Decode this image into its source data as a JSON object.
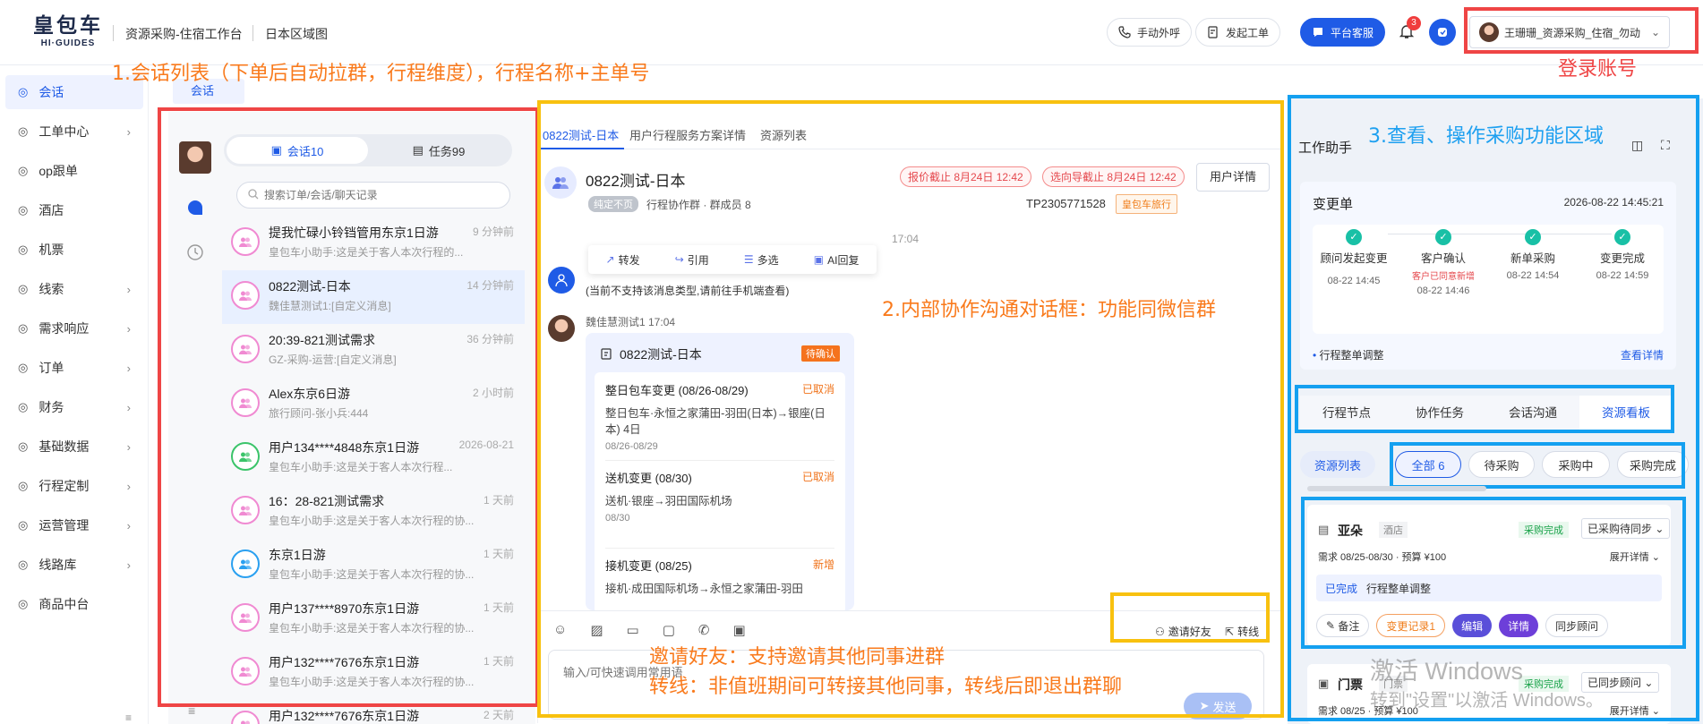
{
  "brand": {
    "name_cn": "皇包车",
    "name_en": "HI·GUIDES"
  },
  "header": {
    "workspace": "资源采购-住宿工作台",
    "region": "日本区域图",
    "call_label": "手动外呼",
    "ticket_label": "发起工单",
    "service_label": "平台客服",
    "notification_count": "3",
    "user_label": "王珊珊_资源采购_住宿_勿动"
  },
  "sidebar": {
    "items": [
      {
        "label": "会话",
        "icon": "chat-icon"
      },
      {
        "label": "工单中心",
        "icon": "ticket-icon"
      },
      {
        "label": "op跟单",
        "icon": "track-icon"
      },
      {
        "label": "酒店",
        "icon": "hotel-icon"
      },
      {
        "label": "机票",
        "icon": "plane-icon"
      },
      {
        "label": "线索",
        "icon": "lead-icon"
      },
      {
        "label": "需求响应",
        "icon": "demand-icon"
      },
      {
        "label": "订单",
        "icon": "order-icon"
      },
      {
        "label": "财务",
        "icon": "finance-icon"
      },
      {
        "label": "基础数据",
        "icon": "data-icon"
      },
      {
        "label": "行程定制",
        "icon": "itinerary-icon"
      },
      {
        "label": "运营管理",
        "icon": "ops-icon"
      },
      {
        "label": "线路库",
        "icon": "route-icon"
      },
      {
        "label": "商品中台",
        "icon": "goods-icon"
      }
    ]
  },
  "page_tab": "会话",
  "annotations": {
    "a1": "1.会话列表（下单后自动拉群，行程维度），行程名称+主单号",
    "a2": "2.内部协作沟通对话框：功能同微信群",
    "a3": "3.查看、操作采购功能区域",
    "login": "登录账号",
    "invite": "邀请好友：支持邀请其他同事进群",
    "transfer": "转线：非值班期间可转接其他同事，转线后即退出群聊"
  },
  "chat_list": {
    "tab_sessions": "会话10",
    "tab_tasks": "任务99",
    "search_placeholder": "搜索订单/会话/聊天记录",
    "items": [
      {
        "title": "提我忙碌小铃铛管用东京1日游",
        "sub": "皇包车小助手:这是关于客人本次行程的...",
        "time": "9 分钟前"
      },
      {
        "title": "0822测试-日本",
        "sub": "魏佳慧测试1:[自定义消息]",
        "time": "14 分钟前"
      },
      {
        "title": "20:39-821测试需求",
        "sub": "GZ-采购-运营:[自定义消息]",
        "time": "36 分钟前"
      },
      {
        "title": "Alex东京6日游",
        "sub": "旅行顾问-张小兵:444",
        "time": "2 小时前"
      },
      {
        "title": "用户134****4848东京1日游",
        "sub": "皇包车小助手:这是关于客人本次行程...",
        "time": "2026-08-21"
      },
      {
        "title": "16：28-821测试需求",
        "sub": "皇包车小助手:这是关于客人本次行程的协...",
        "time": "1 天前"
      },
      {
        "title": "东京1日游",
        "sub": "皇包车小助手:这是关于客人本次行程的协...",
        "time": "1 天前"
      },
      {
        "title": "用户137****8970东京1日游",
        "sub": "皇包车小助手:这是关于客人本次行程的协...",
        "time": "1 天前"
      },
      {
        "title": "用户132****7676东京1日游",
        "sub": "皇包车小助手:这是关于客人本次行程的协...",
        "time": "1 天前"
      },
      {
        "title": "用户132****7676东京1日游",
        "sub": "",
        "time": "2 天前"
      }
    ]
  },
  "conversation": {
    "tabs": [
      "0822测试-日本",
      "用户行程服务方案详情",
      "资源列表"
    ],
    "title": "0822测试-日本",
    "badge": "纯定不页",
    "group_info": "行程协作群 · 群成员 8",
    "deadline_quote": "报价截止 8月24日 12:42",
    "deadline_guide": "选向导截止 8月24日 12:42",
    "user_detail": "用户详情",
    "order_no": "TP2305771528",
    "order_tag": "皇包车旅行",
    "timestamp": "17:04",
    "actions": [
      "转发",
      "引用",
      "多选",
      "AI回复"
    ],
    "system_msg": "(当前不支持该消息类型,请前往手机端查看)",
    "sender": "魏佳慧测试1 17:04",
    "card_title": "0822测试-日本",
    "card_status": "待确认",
    "card_items": [
      {
        "title": "整日包车变更 (08/26-08/29)",
        "status": "已取消",
        "desc": "整日包车·永恒之家蒲田-羽田(日本)→银座(日本) 4日",
        "date": "08/26-08/29"
      },
      {
        "title": "送机变更 (08/30)",
        "status": "已取消",
        "desc": "送机·银座→羽田国际机场",
        "date": "08/30"
      },
      {
        "title": "接机变更 (08/25)",
        "status": "新增",
        "desc": "接机·成田国际机场→永恒之家蒲田-羽田",
        "date": ""
      }
    ],
    "invite_label": "邀请好友",
    "transfer_label": "转线",
    "input_placeholder": "输入/可快速调用常用语",
    "send_label": "发送"
  },
  "assistant": {
    "title": "工作助手",
    "change_title": "变更单",
    "change_time": "2026-08-22 14:45:21",
    "steps": [
      {
        "label": "顾问发起变更",
        "note": "",
        "time": "08-22 14:45"
      },
      {
        "label": "客户确认",
        "note": "客户已同意新增",
        "time": "08-22 14:46"
      },
      {
        "label": "新单采购",
        "note": "",
        "time": "08-22 14:54"
      },
      {
        "label": "变更完成",
        "note": "",
        "time": "08-22 14:59"
      }
    ],
    "item_label": "行程整单调整",
    "view_detail": "查看详情",
    "tabs": [
      "行程节点",
      "协作任务",
      "会话沟通",
      "资源看板"
    ],
    "list_tab": "资源列表",
    "filters": [
      "全部 6",
      "待采购",
      "采购中",
      "采购完成"
    ],
    "resource1": {
      "name": "亚朵",
      "type": "酒店",
      "status": "采购完成",
      "sync": "已采购待同步",
      "need": "需求 08/25-08/30 · 预算 ¥100",
      "expand": "展开详情",
      "done_tag": "已完成",
      "done_desc": "行程整单调整",
      "buttons": [
        "备注",
        "变更记录1",
        "编辑",
        "详情",
        "同步顾问"
      ]
    },
    "resource2": {
      "name": "门票",
      "type": "门票",
      "status": "采购完成",
      "sync": "已同步顾问",
      "need": "需求 08/25 · 预算 ¥100",
      "expand": "展开详情"
    }
  },
  "watermark": {
    "line1": "激活 Windows",
    "line2": "转到\"设置\"以激活 Windows。"
  },
  "colors": {
    "accent": "#1f5be6",
    "anno_orange": "#f97a1c",
    "anno_blue": "#1ea0f0",
    "box_red": "#ef4545",
    "box_yellow": "#f8c10f",
    "box_blue": "#14a0f0"
  }
}
